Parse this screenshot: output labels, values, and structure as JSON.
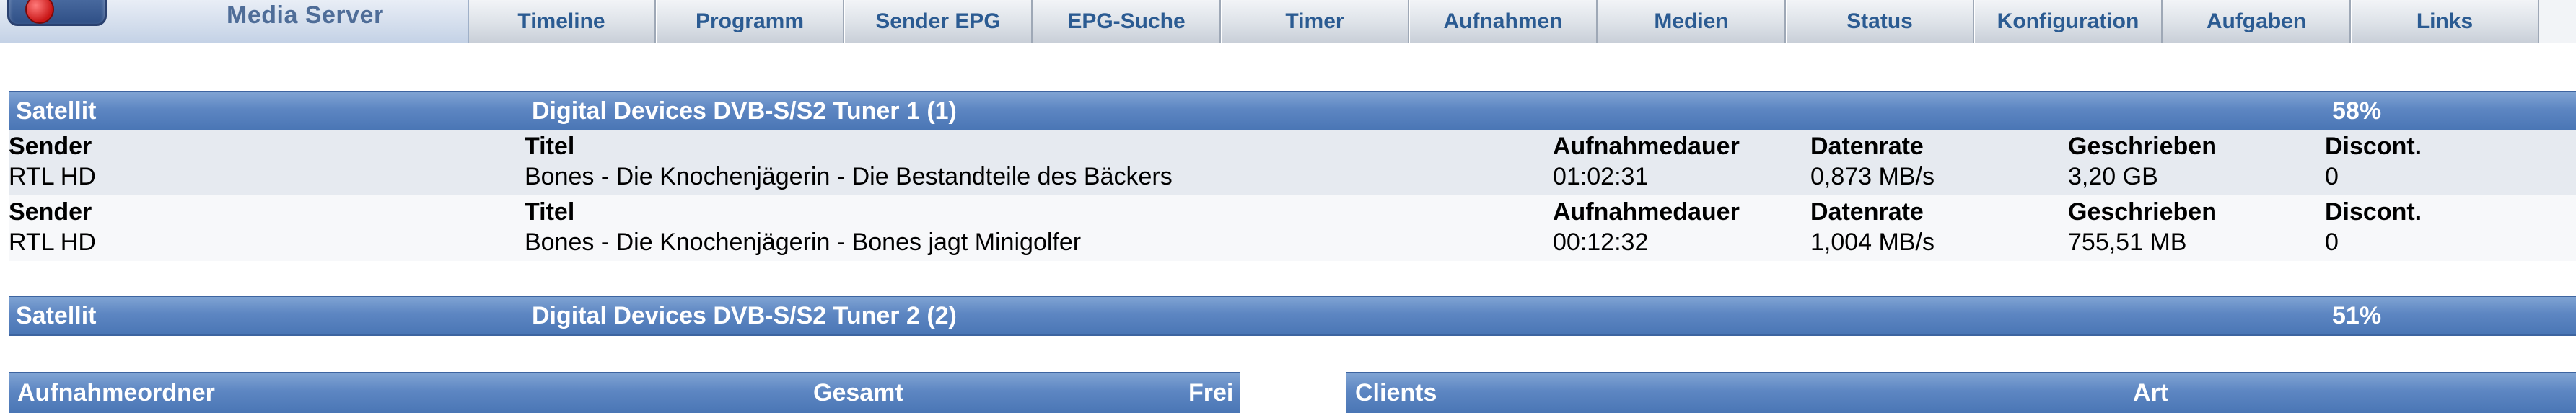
{
  "app": {
    "logo_text": "Media Server"
  },
  "nav": {
    "items": [
      {
        "label": "Timeline"
      },
      {
        "label": "Programm"
      },
      {
        "label": "Sender EPG"
      },
      {
        "label": "EPG-Suche"
      },
      {
        "label": "Timer"
      },
      {
        "label": "Aufnahmen"
      },
      {
        "label": "Medien"
      },
      {
        "label": "Status"
      },
      {
        "label": "Konfiguration"
      },
      {
        "label": "Aufgaben"
      },
      {
        "label": "Links"
      }
    ]
  },
  "tuners": [
    {
      "type": "Satellit",
      "name": "Digital Devices DVB-S/S2 Tuner 1 (1)",
      "load": "58%",
      "recordings": [
        {
          "headers": {
            "sender": "Sender",
            "titel": "Titel",
            "dauer": "Aufnahmedauer",
            "rate": "Datenrate",
            "geschrieben": "Geschrieben",
            "discont": "Discont."
          },
          "sender": "RTL HD",
          "titel": "Bones - Die Knochenjägerin - Die Bestandteile des Bäckers",
          "dauer": "01:02:31",
          "rate": "0,873 MB/s",
          "geschrieben": "3,20 GB",
          "discont": "0"
        },
        {
          "headers": {
            "sender": "Sender",
            "titel": "Titel",
            "dauer": "Aufnahmedauer",
            "rate": "Datenrate",
            "geschrieben": "Geschrieben",
            "discont": "Discont."
          },
          "sender": "RTL HD",
          "titel": "Bones - Die Knochenjägerin - Bones jagt Minigolfer",
          "dauer": "00:12:32",
          "rate": "1,004 MB/s",
          "geschrieben": "755,51 MB",
          "discont": "0"
        }
      ]
    },
    {
      "type": "Satellit",
      "name": "Digital Devices DVB-S/S2 Tuner 2 (2)",
      "load": "51%",
      "recordings": []
    }
  ],
  "folders_panel": {
    "col_folder": "Aufnahmeordner",
    "col_total": "Gesamt",
    "col_free": "Frei"
  },
  "clients_panel": {
    "col_clients": "Clients",
    "col_type": "Art"
  },
  "colors": {
    "bar_blue": "#5d86c2",
    "nav_text": "#2b5b92",
    "row_alt": "#e6eaf0"
  }
}
